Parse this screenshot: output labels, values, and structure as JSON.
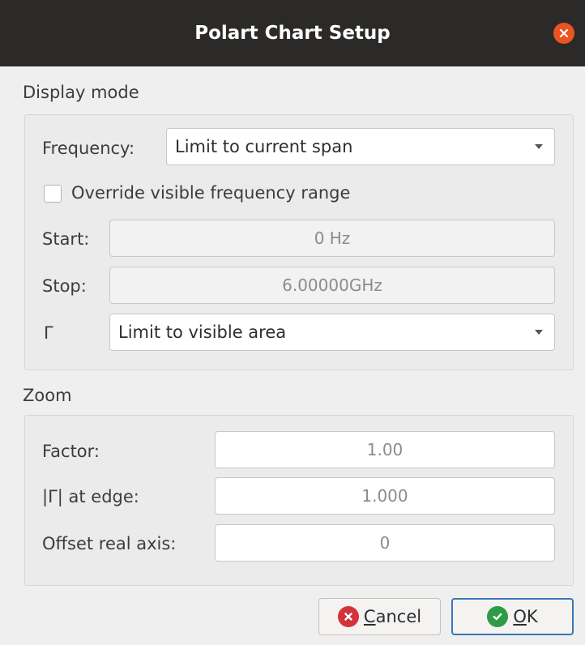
{
  "window": {
    "title": "Polart Chart Setup"
  },
  "display_mode": {
    "section_label": "Display mode",
    "frequency_label": "Frequency:",
    "frequency_value": "Limit to current span",
    "override_label": "Override visible frequency range",
    "override_checked": false,
    "start_label": "Start:",
    "start_value": "0 Hz",
    "stop_label": "Stop:",
    "stop_value": "6.00000GHz",
    "gamma_label": "Γ",
    "gamma_value": "Limit to visible area"
  },
  "zoom": {
    "section_label": "Zoom",
    "factor_label": "Factor:",
    "factor_value": "1.00",
    "edge_label": "|Γ| at edge:",
    "edge_value": "1.000",
    "offset_label": "Offset real axis:",
    "offset_value": "0"
  },
  "buttons": {
    "cancel_mnemonic": "C",
    "cancel_rest": "ancel",
    "ok_mnemonic": "O",
    "ok_rest": "K"
  },
  "colors": {
    "titlebar": "#2b2a28",
    "close": "#e95420",
    "ok_border": "#3b75b8"
  }
}
